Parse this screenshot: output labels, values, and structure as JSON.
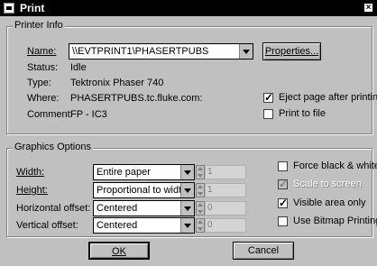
{
  "window": {
    "title": "Print",
    "close_glyph": "×"
  },
  "printer_info": {
    "group_title": "Printer Info",
    "name_label": "Name:",
    "name_value": "\\\\EVTPRINT1\\PHASERTPUBS",
    "properties_button": "Properties...",
    "status_label": "Status:",
    "status_value": "Idle",
    "type_label": "Type:",
    "type_value": "Tektronix Phaser 740",
    "where_label": "Where:",
    "where_value": "PHASERTPUBS.tc.fluke.com:",
    "comment_label": "Comment:",
    "comment_value": "FP - IC3",
    "eject_label": "Eject page after printing",
    "eject_checked": true,
    "print_to_file_label": "Print to file",
    "print_to_file_checked": false
  },
  "graphics_options": {
    "group_title": "Graphics Options",
    "width_label": "Width:",
    "width_value": "Entire paper",
    "width_spin": "1",
    "height_label": "Height:",
    "height_value": "Proportional to width",
    "height_spin": "1",
    "hoffset_label": "Horizontal offset:",
    "hoffset_value": "Centered",
    "hoffset_spin": "0",
    "voffset_label": "Vertical offset:",
    "voffset_value": "Centered",
    "voffset_spin": "0",
    "force_bw_label": "Force black & white",
    "force_bw_checked": false,
    "scale_label": "Scale to screen",
    "scale_checked": true,
    "visible_label": "Visible area only",
    "visible_checked": true,
    "bitmap_label": "Use Bitmap Printing",
    "bitmap_checked": false
  },
  "buttons": {
    "ok": "OK",
    "cancel": "Cancel"
  }
}
